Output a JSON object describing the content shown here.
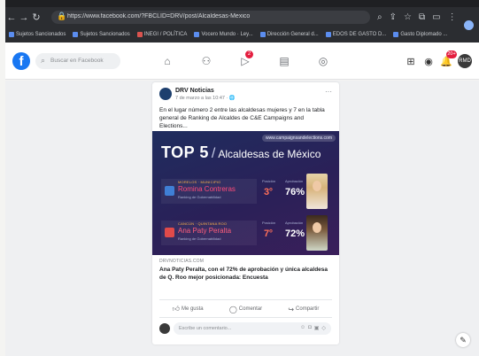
{
  "browser": {
    "url": "https://www.facebook.com/?FBCLID=DRV/post/Alcaldesas-Mexico",
    "nav_icons": [
      "back-icon",
      "forward-icon",
      "reload-icon"
    ],
    "bookmarks": [
      {
        "label": "Sujetos Sancionados",
        "icon": "bookmark-icon"
      },
      {
        "label": "Sujetos Sancionados",
        "icon": "bookmark-icon"
      },
      {
        "label": "INEGI / POLÍTICA",
        "icon": "bookmark-icon"
      },
      {
        "label": "Vocero Mundo · Ley...",
        "icon": "bookmark-icon"
      },
      {
        "label": "Dirección General d...",
        "icon": "bookmark-icon"
      },
      {
        "label": "EDOS DE GASTO D...",
        "icon": "bookmark-icon"
      },
      {
        "label": "Gasto Diplomado ...",
        "icon": "bookmark-icon"
      }
    ]
  },
  "fb": {
    "logo": "f",
    "search_placeholder": "Buscar en Facebook",
    "nav_badge": "2",
    "notif_badge": "20+",
    "profile_initials": "RMD"
  },
  "post": {
    "author": "DRV Noticias",
    "meta": "7 de marzo a las 10:47 · 🌐",
    "menu": "···",
    "text": "En el lugar número 2 entre las alcaldesas mujeres y 7 en la tabla general de Ranking de Alcaldes de C&E Campaigns and Elections...",
    "image": {
      "url": "www.campaignsandelections.com",
      "top5": "TOP 5",
      "slash": "/",
      "subtitle": "Alcaldesas de México",
      "cards": [
        {
          "region": "MORELOS · MUNICIPIO",
          "name": "Romina Contreras",
          "caption": "Ranking de Gobernabilidad",
          "pos_label": "Posición",
          "pos_value": "3",
          "pos_suffix": "o",
          "apr_label": "Aprobación",
          "apr_value": "76%"
        },
        {
          "region": "CANCÚN · QUINTANA ROO",
          "name": "Ana Paty Peralta",
          "caption": "Ranking de Gobernabilidad",
          "pos_label": "Posición",
          "pos_value": "7",
          "pos_suffix": "o",
          "apr_label": "Aprobación",
          "apr_value": "72%"
        }
      ]
    },
    "link_source": "DRVNOTICIAS.COM",
    "link_title": "Ana Paty Peralta, con el 72% de aprobación y única alcaldesa de Q. Roo mejor posicionada: Encuesta",
    "actions": {
      "like": "Me gusta",
      "comment": "Comentar",
      "share": "Compartir"
    },
    "comment_placeholder": "Escribe un comentario..."
  }
}
